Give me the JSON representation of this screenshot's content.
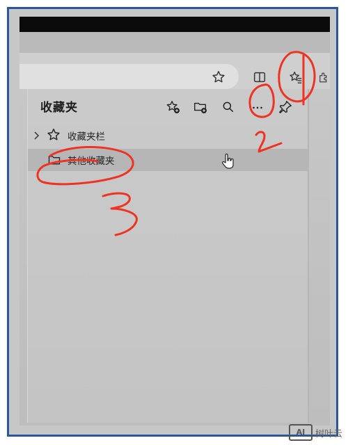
{
  "favorites_panel": {
    "title": "收藏夹",
    "toolbar_icons": [
      "star-plus-icon",
      "folder-plus-icon",
      "search-icon",
      "more-options-icon",
      "pin-icon"
    ],
    "items": [
      {
        "label": "收藏夹栏",
        "icon": "star-icon",
        "has_chevron": true
      },
      {
        "label": "其他收藏夹",
        "icon": "folder-icon",
        "has_chevron": false
      }
    ]
  },
  "browser_toolbar": {
    "icons": [
      "star-icon",
      "split-screen-icon",
      "favorites-icon",
      "extensions-icon"
    ]
  },
  "annotations": [
    "1",
    "2",
    "3"
  ],
  "watermark": {
    "text": "树叶云",
    "logo": "AI"
  },
  "colors": {
    "frame": "#2b5797",
    "ink": "#ee3322"
  }
}
